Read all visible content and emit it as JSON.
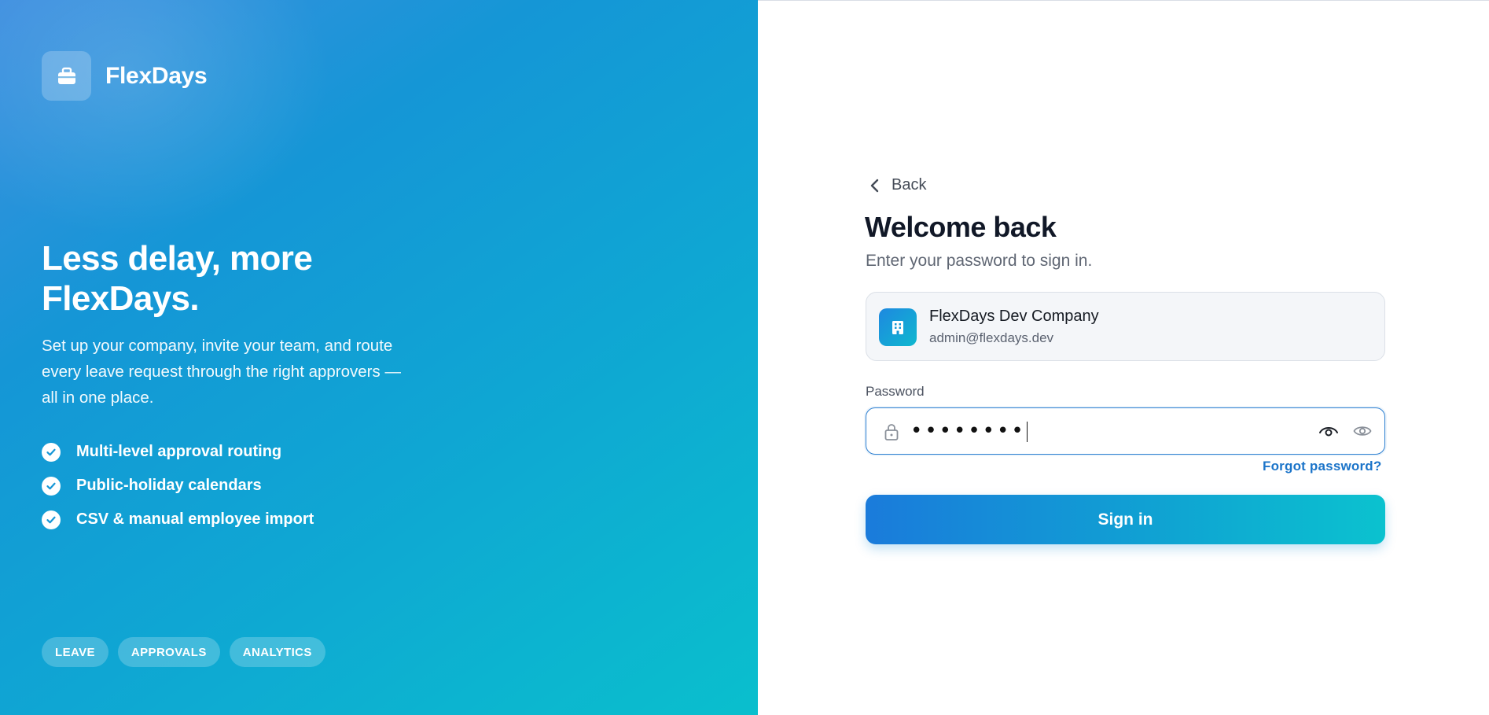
{
  "brand": {
    "name": "FlexDays",
    "logo_icon": "briefcase-icon"
  },
  "hero": {
    "headline": "Less delay, more FlexDays.",
    "description": "Set up your company, invite your team, and route every leave request through the right approvers — all in one place.",
    "features": [
      {
        "label": "Multi-level approval routing"
      },
      {
        "label": "Public-holiday calendars"
      },
      {
        "label": "CSV & manual employee import"
      }
    ],
    "tags": [
      "LEAVE",
      "APPROVALS",
      "ANALYTICS"
    ]
  },
  "auth": {
    "back_label": "Back",
    "title": "Welcome back",
    "subtitle": "Enter your password to sign in.",
    "account": {
      "company_name": "FlexDays Dev Company",
      "email": "admin@flexdays.dev",
      "icon": "building-icon"
    },
    "password_label": "Password",
    "password_value": "••••••••",
    "forgot_label": "Forgot password?",
    "submit_label": "Sign in"
  },
  "colors": {
    "accent": "#1b74c9",
    "gradient_start": "#1a7bdb",
    "gradient_end": "#0bc2cf"
  }
}
